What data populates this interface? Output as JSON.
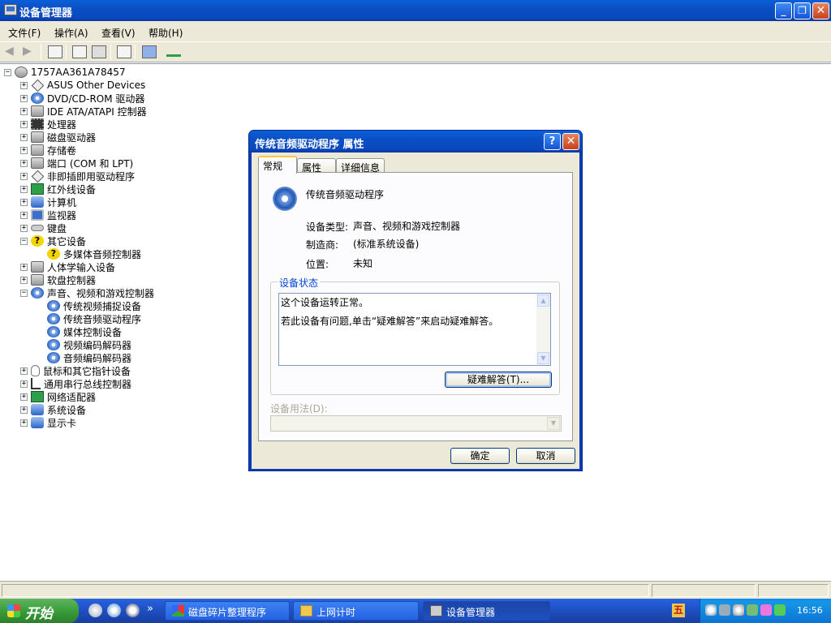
{
  "window": {
    "title": "设备管理器",
    "controls": {
      "minimize": "_",
      "restore": "❐",
      "close": "✕"
    }
  },
  "menu": [
    "文件(F)",
    "操作(A)",
    "查看(V)",
    "帮助(H)"
  ],
  "tree": {
    "root": "1757AA361A78457",
    "items": [
      {
        "label": "ASUS Other Devices",
        "icon": "generic-device-icon",
        "expander": "+"
      },
      {
        "label": "DVD/CD-ROM 驱动器",
        "icon": "dvd-icon",
        "expander": "+"
      },
      {
        "label": "IDE ATA/ATAPI 控制器",
        "icon": "ide-controller-icon",
        "expander": "+"
      },
      {
        "label": "处理器",
        "icon": "processor-icon",
        "expander": "+"
      },
      {
        "label": "磁盘驱动器",
        "icon": "disk-drive-icon",
        "expander": "+"
      },
      {
        "label": "存储卷",
        "icon": "storage-volume-icon",
        "expander": "+"
      },
      {
        "label": "端口 (COM 和 LPT)",
        "icon": "port-icon",
        "expander": "+"
      },
      {
        "label": "非即插即用驱动程序",
        "icon": "generic-device-icon",
        "expander": "+"
      },
      {
        "label": "红外线设备",
        "icon": "infrared-icon",
        "expander": "+"
      },
      {
        "label": "计算机",
        "icon": "computer-icon",
        "expander": "+"
      },
      {
        "label": "监视器",
        "icon": "monitor-icon",
        "expander": "+"
      },
      {
        "label": "键盘",
        "icon": "keyboard-icon",
        "expander": "+"
      },
      {
        "label": "其它设备",
        "icon": "unknown-device-icon",
        "expander": "−"
      },
      {
        "label": "多媒体音频控制器",
        "icon": "unknown-device-icon",
        "expander": "",
        "child": true
      },
      {
        "label": "人体学输入设备",
        "icon": "hid-icon",
        "expander": "+"
      },
      {
        "label": "软盘控制器",
        "icon": "floppy-controller-icon",
        "expander": "+"
      },
      {
        "label": "声音、视频和游戏控制器",
        "icon": "sound-icon",
        "expander": "−"
      },
      {
        "label": "传统视频捕捉设备",
        "icon": "sound-icon",
        "expander": "",
        "child": true
      },
      {
        "label": "传统音频驱动程序",
        "icon": "sound-icon",
        "expander": "",
        "child": true
      },
      {
        "label": "媒体控制设备",
        "icon": "sound-icon",
        "expander": "",
        "child": true
      },
      {
        "label": "视频编码解码器",
        "icon": "sound-icon",
        "expander": "",
        "child": true
      },
      {
        "label": "音频编码解码器",
        "icon": "sound-icon",
        "expander": "",
        "child": true
      },
      {
        "label": "鼠标和其它指针设备",
        "icon": "mouse-icon",
        "expander": "+"
      },
      {
        "label": "通用串行总线控制器",
        "icon": "usb-icon",
        "expander": "+"
      },
      {
        "label": "网络适配器",
        "icon": "network-adapter-icon",
        "expander": "+"
      },
      {
        "label": "系统设备",
        "icon": "system-device-icon",
        "expander": "+"
      },
      {
        "label": "显示卡",
        "icon": "display-adapter-icon",
        "expander": "+"
      }
    ]
  },
  "dialog": {
    "title": "传统音频驱动程序 属性",
    "help": "?",
    "close": "✕",
    "tabs": [
      "常规",
      "属性",
      "详细信息"
    ],
    "device_name": "传统音频驱动程序",
    "fields": {
      "type_label": "设备类型:",
      "type_value": "声音、视频和游戏控制器",
      "maker_label": "制造商:",
      "maker_value": "(标准系统设备)",
      "location_label": "位置:",
      "location_value": "未知"
    },
    "status_group": "设备状态",
    "status_line1": "这个设备运转正常。",
    "status_line2": "若此设备有问题,单击“疑难解答”来启动疑难解答。",
    "troubleshoot": "疑难解答(T)...",
    "usage_label": "设备用法(D):",
    "usage_value": "",
    "ok": "确定",
    "cancel": "取消"
  },
  "taskbar": {
    "start": "开始",
    "more": "»",
    "tasks": [
      "磁盘碎片整理程序",
      "上网计时",
      "设备管理器"
    ],
    "tray_ime": "五",
    "clock": "16:56"
  },
  "colors": {
    "xp_blue": "#0a48bd",
    "xp_face": "#ece9d8",
    "group_title": "#0046d5",
    "tab_highlight": "#ffc83c"
  }
}
